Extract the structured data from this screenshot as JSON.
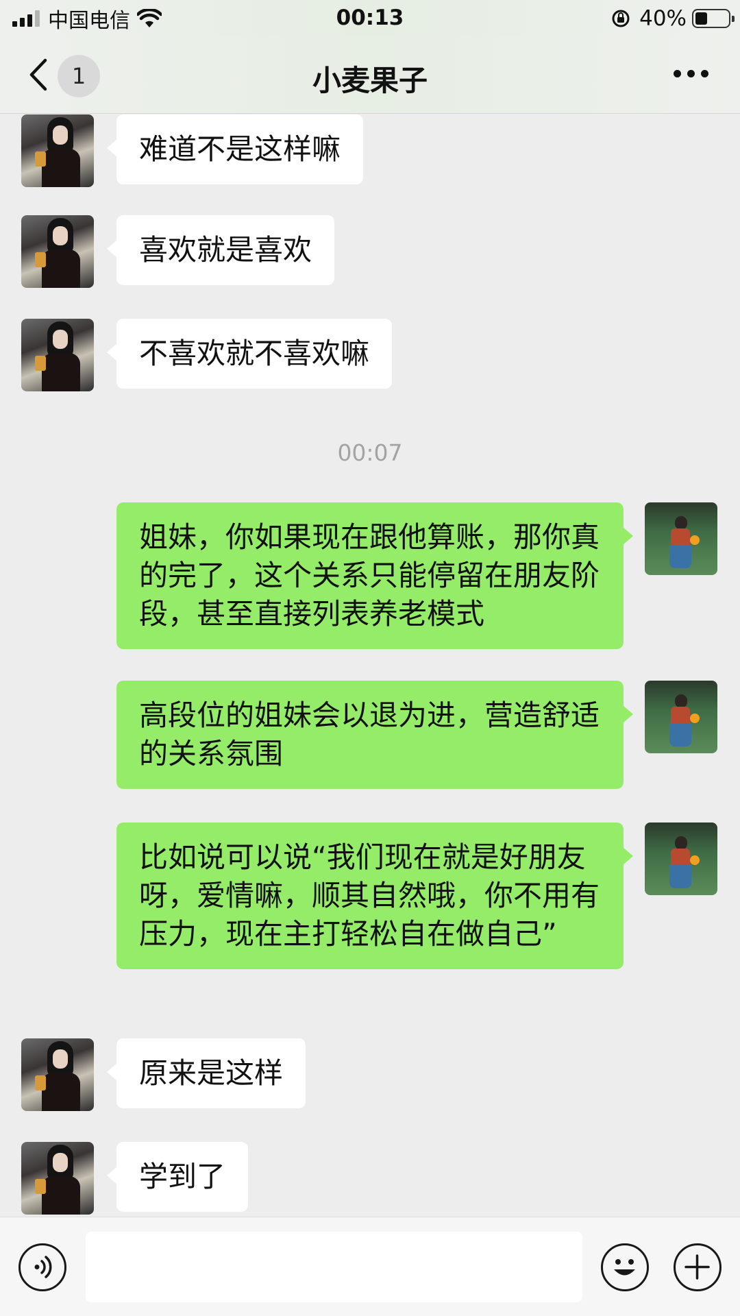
{
  "status_bar": {
    "carrier": "中国电信",
    "time": "00:13",
    "battery_percent": "40%",
    "signal_bars": 3,
    "battery_level": 0.4
  },
  "nav": {
    "unread_count": "1",
    "title": "小麦果子",
    "back_icon": "chevron-left-icon",
    "more_icon": "more-dots-icon"
  },
  "messages": [
    {
      "side": "left",
      "text": "难道不是这样嘛"
    },
    {
      "side": "left",
      "text": "喜欢就是喜欢"
    },
    {
      "side": "left",
      "text": "不喜欢就不喜欢嘛"
    },
    {
      "side": "right",
      "text": "姐妹，你如果现在跟他算账，那你真的完了，这个关系只能停留在朋友阶段，甚至直接列表养老模式"
    },
    {
      "side": "right",
      "text": "高段位的姐妹会以退为进，营造舒适的关系氛围"
    },
    {
      "side": "right",
      "text": "比如说可以说“我们现在就是好朋友呀，爱情嘛，顺其自然哦，你不用有压力，现在主打轻松自在做自己”"
    },
    {
      "side": "left",
      "text": "原来是这样"
    },
    {
      "side": "left",
      "text": "学到了"
    }
  ],
  "timestamp": "00:07",
  "input_bar": {
    "input_value": "",
    "voice_icon": "voice-icon",
    "emoji_icon": "emoji-icon",
    "plus_icon": "plus-icon"
  },
  "colors": {
    "chat_background": "#ededed",
    "sent_bubble": "#95ec69",
    "received_bubble": "#ffffff"
  }
}
